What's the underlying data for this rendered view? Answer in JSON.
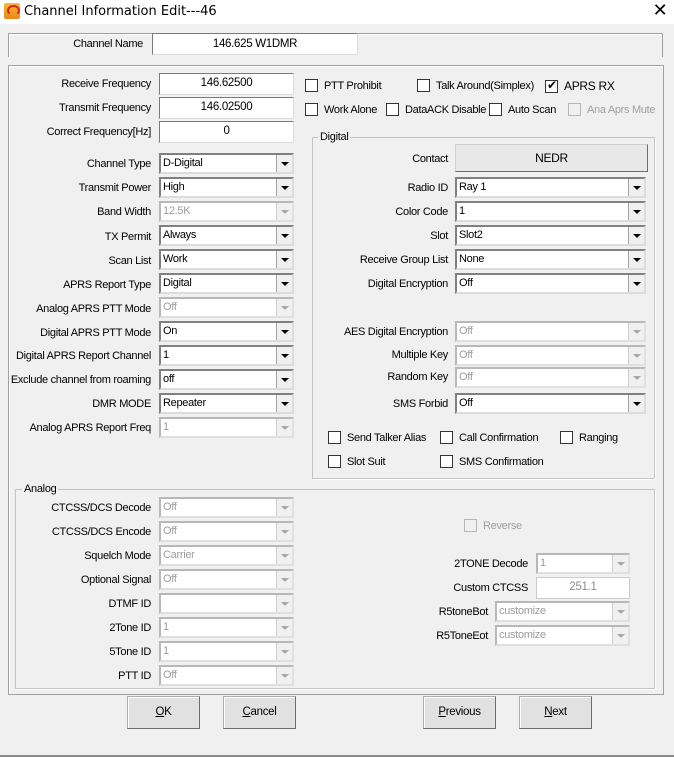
{
  "window": {
    "title": "Channel Information Edit---46",
    "close_icon": "close-icon",
    "app_icon": "app-logo-icon"
  },
  "channel_name": {
    "label": "Channel Name",
    "value": "146.625 W1DMR"
  },
  "general": {
    "receive_frequency": {
      "label": "Receive Frequency",
      "value": "146.62500"
    },
    "transmit_frequency": {
      "label": "Transmit Frequency",
      "value": "146.02500"
    },
    "correct_frequency": {
      "label": "Correct Frequency[Hz]",
      "value": "0"
    },
    "channel_type": {
      "label": "Channel Type",
      "value": "D-Digital"
    },
    "transmit_power": {
      "label": "Transmit Power",
      "value": "High"
    },
    "band_width": {
      "label": "Band Width",
      "value": "12.5K"
    },
    "tx_permit": {
      "label": "TX Permit",
      "value": "Always"
    },
    "scan_list": {
      "label": "Scan List",
      "value": "Work"
    },
    "aprs_report_type": {
      "label": "APRS Report Type",
      "value": "Digital"
    },
    "analog_aprs_ptt_mode": {
      "label": "Analog APRS PTT Mode",
      "value": "Off"
    },
    "digital_aprs_ptt_mode": {
      "label": "Digital APRS PTT Mode",
      "value": "On"
    },
    "digital_aprs_report_channel": {
      "label": "Digital APRS Report Channel",
      "value": "1"
    },
    "exclude_roaming": {
      "label": "Exclude channel from roaming",
      "value": "off"
    },
    "dmr_mode": {
      "label": "DMR MODE",
      "value": "Repeater"
    },
    "analog_aprs_report_freq": {
      "label": "Analog APRS Report Freq",
      "value": "1"
    }
  },
  "checkboxes": {
    "ptt_prohibit": {
      "label": "PTT Prohibit",
      "checked": false
    },
    "talk_around": {
      "label": "Talk Around(Simplex)",
      "checked": false
    },
    "aprs_rx": {
      "label": "APRS RX",
      "checked": true
    },
    "work_alone": {
      "label": "Work Alone",
      "checked": false
    },
    "data_ack_disable": {
      "label": "DataACK Disable",
      "checked": false
    },
    "auto_scan": {
      "label": "Auto Scan",
      "checked": false
    },
    "ana_aprs_mute": {
      "label": "Ana Aprs Mute",
      "checked": false,
      "disabled": true
    }
  },
  "digital": {
    "title": "Digital",
    "contact": {
      "label": "Contact",
      "value": "NEDR"
    },
    "radio_id": {
      "label": "Radio ID",
      "value": "Ray 1"
    },
    "color_code": {
      "label": "Color Code",
      "value": "1"
    },
    "slot": {
      "label": "Slot",
      "value": "Slot2"
    },
    "receive_group_list": {
      "label": "Receive Group List",
      "value": "None"
    },
    "digital_encryption": {
      "label": "Digital Encryption",
      "value": "Off"
    },
    "aes_digital_encryption": {
      "label": "AES Digital Encryption",
      "value": "Off"
    },
    "multiple_key": {
      "label": "Multiple Key",
      "value": "Off"
    },
    "random_key": {
      "label": "Random Key",
      "value": "Off"
    },
    "sms_forbid": {
      "label": "SMS Forbid",
      "value": "Off"
    },
    "send_talker_alias": {
      "label": "Send Talker Alias",
      "checked": false
    },
    "call_confirmation": {
      "label": "Call Confirmation",
      "checked": false
    },
    "ranging": {
      "label": "Ranging",
      "checked": false
    },
    "slot_suit": {
      "label": "Slot Suit",
      "checked": false
    },
    "sms_confirmation": {
      "label": "SMS Confirmation",
      "checked": false
    }
  },
  "analog": {
    "title": "Analog",
    "ctcss_decode": {
      "label": "CTCSS/DCS Decode",
      "value": "Off"
    },
    "ctcss_encode": {
      "label": "CTCSS/DCS Encode",
      "value": "Off"
    },
    "squelch_mode": {
      "label": "Squelch Mode",
      "value": "Carrier"
    },
    "optional_signal": {
      "label": "Optional Signal",
      "value": "Off"
    },
    "dtmf_id": {
      "label": "DTMF ID",
      "value": ""
    },
    "two_tone_id": {
      "label": "2Tone ID",
      "value": "1"
    },
    "five_tone_id": {
      "label": "5Tone ID",
      "value": "1"
    },
    "ptt_id": {
      "label": "PTT ID",
      "value": "Off"
    },
    "reverse": {
      "label": "Reverse",
      "checked": false,
      "disabled": true
    },
    "two_tone_decode": {
      "label": "2TONE Decode",
      "value": "1"
    },
    "custom_ctcss": {
      "label": "Custom CTCSS",
      "value": "251.1"
    },
    "r5tone_bot": {
      "label": "R5toneBot",
      "value": "customize"
    },
    "r5tone_eot": {
      "label": "R5ToneEot",
      "value": "customize"
    }
  },
  "buttons": {
    "ok": {
      "mnemonic": "O",
      "rest": "K"
    },
    "cancel": {
      "mnemonic": "C",
      "rest": "ancel"
    },
    "previous": {
      "mnemonic": "P",
      "rest": "revious"
    },
    "next": {
      "mnemonic": "N",
      "rest": "ext"
    }
  }
}
